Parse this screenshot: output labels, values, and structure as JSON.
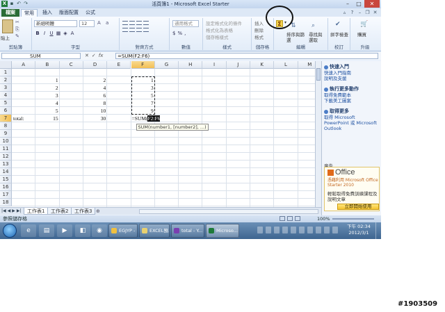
{
  "window": {
    "title": "活頁簿1 - Microsoft Excel Starter",
    "minimize": "–",
    "maximize": "□",
    "close": "✕"
  },
  "tabs": {
    "file": "檔案",
    "home": "常用",
    "insert": "插入",
    "page_layout": "版面配置",
    "formulas": "公式"
  },
  "ribbon": {
    "clipboard": {
      "paste": "貼上",
      "label": "剪貼簿"
    },
    "font": {
      "name": "新細明體",
      "size": "12",
      "label": "字型"
    },
    "alignment": {
      "label": "對齊方式"
    },
    "number": {
      "format": "通用格式",
      "label": "數值"
    },
    "styles": {
      "items": [
        "設定格式化的條件",
        "格式化為表格",
        "儲存格樣式"
      ],
      "label": "樣式"
    },
    "cells": {
      "items": [
        "插入",
        "刪除",
        "格式"
      ],
      "label": "儲存格"
    },
    "editing": {
      "sigma": "Σ",
      "sort_filter": "排序與篩選",
      "find_select": "尋找與選取",
      "label": "編輯"
    },
    "proofing": {
      "spelling": "拼字檢查",
      "label": "校訂"
    },
    "upgrade": {
      "button": "購買",
      "label": "升級"
    }
  },
  "formula_bar": {
    "name_box": "SUM",
    "cancel": "✕",
    "enter": "✓",
    "fx": "fx",
    "formula": "=SUM(F2:F6)"
  },
  "sheet": {
    "columns": [
      "A",
      "B",
      "C",
      "D",
      "E",
      "F",
      "G",
      "H",
      "I",
      "J",
      "K",
      "L",
      "M"
    ],
    "rows": [
      "1",
      "2",
      "3",
      "4",
      "5",
      "6",
      "7",
      "8",
      "9",
      "10",
      "11",
      "12",
      "13",
      "14",
      "15",
      "16",
      "17",
      "18"
    ],
    "cells": {
      "A7": "total:",
      "B2": "1",
      "B3": "2",
      "B4": "3",
      "B5": "4",
      "B6": "5",
      "B7": "15",
      "D2": "2",
      "D3": "4",
      "D4": "6",
      "D5": "8",
      "D6": "10",
      "D7": "30",
      "F2": "1",
      "F3": "3",
      "F4": "5",
      "F5": "7",
      "F6": "9"
    },
    "editing_cell": {
      "prefix": "=SUM(",
      "ref": "F2:F6"
    },
    "tooltip": "SUM(number1, [number2], ...)",
    "tabs": [
      "工作表1",
      "工作表2",
      "工作表3"
    ]
  },
  "status": {
    "text": "參照儲存格",
    "zoom": "100%"
  },
  "side_pane": {
    "quick_start": {
      "title": "快速入門",
      "links": [
        "快速入門指南",
        "說明及支援"
      ]
    },
    "do_more": {
      "title": "執行更多動作",
      "links": [
        "取得免費範本",
        "下載美工圖案"
      ]
    },
    "get_more": {
      "title": "取得更多",
      "text": "取得 Microsoft PowerPoint 或 Microsoft Outlook"
    },
    "ad": {
      "label": "廣告",
      "brand": "Office",
      "subtitle": "憑藉利用 Microsoft Office Starter 2010",
      "body": "輕鬆取得免費訓練課程及說明文章",
      "button": "立即開始使用"
    }
  },
  "taskbar": {
    "items": [
      "EGJYP - ...",
      "EXCEL預...",
      "total - Y...",
      "Microso..."
    ],
    "clock": {
      "time": "下午 02:34",
      "date": "2012/3/1"
    }
  },
  "watermark": "#1903509"
}
